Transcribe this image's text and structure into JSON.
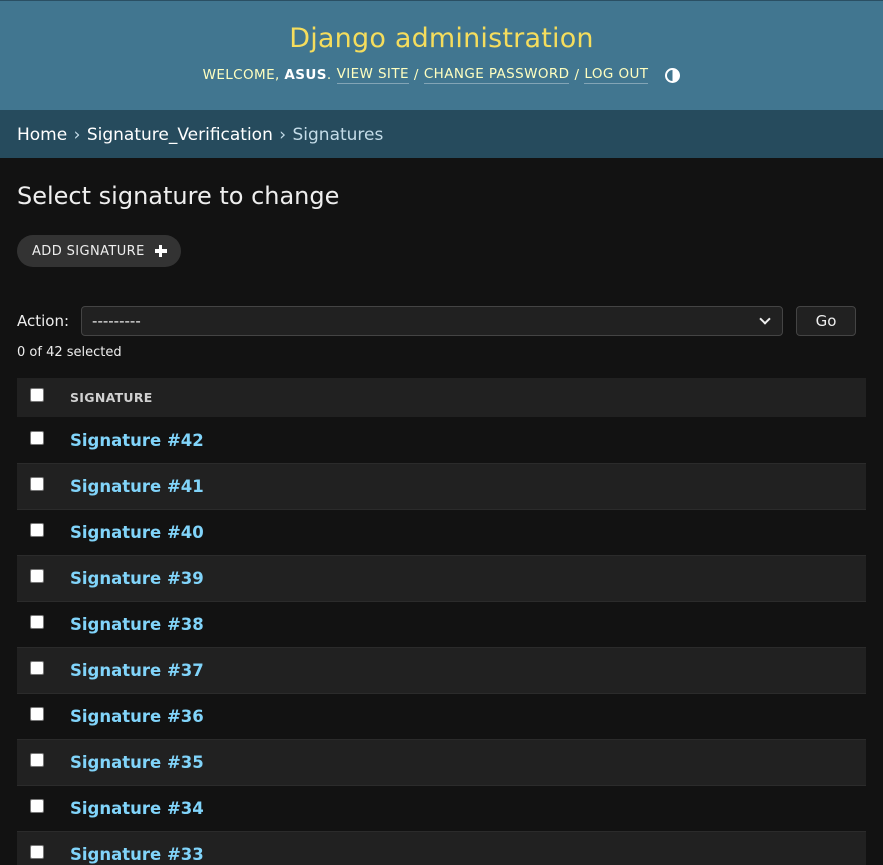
{
  "header": {
    "site_name": "Django administration",
    "welcome": "WELCOME,",
    "username": "ASUS",
    "view_site": "VIEW SITE",
    "change_password": "CHANGE PASSWORD",
    "log_out": "LOG OUT",
    "separator": "/"
  },
  "breadcrumbs": {
    "home": "Home",
    "app": "Signature_Verification",
    "current": "Signatures",
    "separator": "›"
  },
  "page": {
    "title": "Select signature to change",
    "add_button": "ADD SIGNATURE"
  },
  "actions": {
    "label": "Action:",
    "selected_option": "---------",
    "go_button": "Go",
    "counter": "0 of 42 selected"
  },
  "table": {
    "column_header": "SIGNATURE",
    "rows": [
      "Signature #42",
      "Signature #41",
      "Signature #40",
      "Signature #39",
      "Signature #38",
      "Signature #37",
      "Signature #36",
      "Signature #35",
      "Signature #34",
      "Signature #33"
    ]
  },
  "colors": {
    "header_bg": "#417690",
    "breadcrumbs_bg": "#264b5d",
    "site_name": "#f5dd5d",
    "link": "#81d4fa",
    "body_bg": "#121212"
  }
}
